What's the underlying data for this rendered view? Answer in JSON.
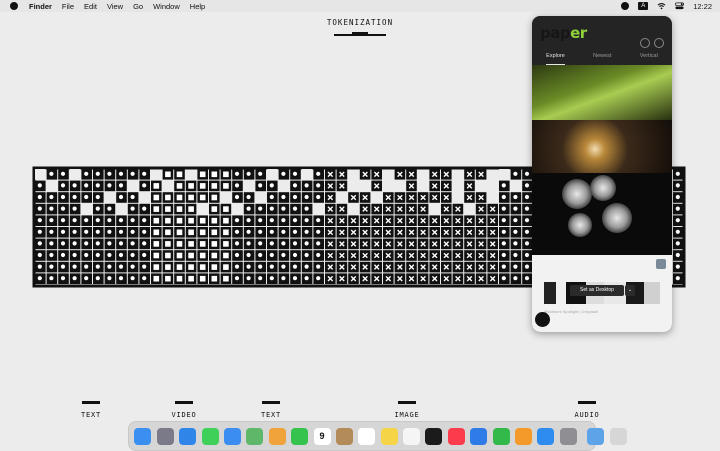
{
  "menubar": {
    "app_name": "Finder",
    "menus": [
      "File",
      "Edit",
      "View",
      "Go",
      "Window",
      "Help"
    ],
    "clock": "12:22",
    "keyboard_indicator": "A"
  },
  "canvas": {
    "title": "TOKENIZATION",
    "segments": [
      {
        "label": "TEXT"
      },
      {
        "label": "VIDEO"
      },
      {
        "label": "TEXT"
      },
      {
        "label": "IMAGE"
      },
      {
        "label": "AUDIO"
      }
    ]
  },
  "panel": {
    "logo_prefix": "pap",
    "logo_suffix": "er",
    "tabs": [
      {
        "label": "Explore",
        "active": true
      },
      {
        "label": "Newest",
        "active": false
      },
      {
        "label": "Vertical",
        "active": false
      }
    ],
    "set_desktop_label": "Set as Desktop",
    "caret": "⌄",
    "photo_credit": "@Artwork Spotlight | Unsplash"
  },
  "dock": {
    "apps": [
      {
        "name": "finder",
        "color": "#3b8ff0"
      },
      {
        "name": "launchpad",
        "color": "#7a7a88"
      },
      {
        "name": "safari",
        "color": "#2f86e8"
      },
      {
        "name": "messages",
        "color": "#3fd05a"
      },
      {
        "name": "mail",
        "color": "#3c8df2"
      },
      {
        "name": "maps",
        "color": "#5fb86a"
      },
      {
        "name": "photos",
        "color": "#f0a33a"
      },
      {
        "name": "facetime",
        "color": "#35c24d"
      },
      {
        "name": "calendar",
        "color": "#ffffff",
        "text": "9"
      },
      {
        "name": "notes-brown",
        "color": "#b38b58"
      },
      {
        "name": "reminders",
        "color": "#ffffff"
      },
      {
        "name": "notes",
        "color": "#f5d547"
      },
      {
        "name": "freeform",
        "color": "#f5f5f5"
      },
      {
        "name": "apple-tv",
        "color": "#1b1b1b"
      },
      {
        "name": "music",
        "color": "#fa3c4c"
      },
      {
        "name": "keynote",
        "color": "#2f7be8"
      },
      {
        "name": "numbers",
        "color": "#33b94a"
      },
      {
        "name": "pages",
        "color": "#f39a2b"
      },
      {
        "name": "app-store",
        "color": "#2e8cf0"
      },
      {
        "name": "system-settings",
        "color": "#8e8e93"
      },
      {
        "name": "downloads-folder",
        "color": "#5ca3e8"
      },
      {
        "name": "trash",
        "color": "#d6d6d6"
      }
    ]
  }
}
